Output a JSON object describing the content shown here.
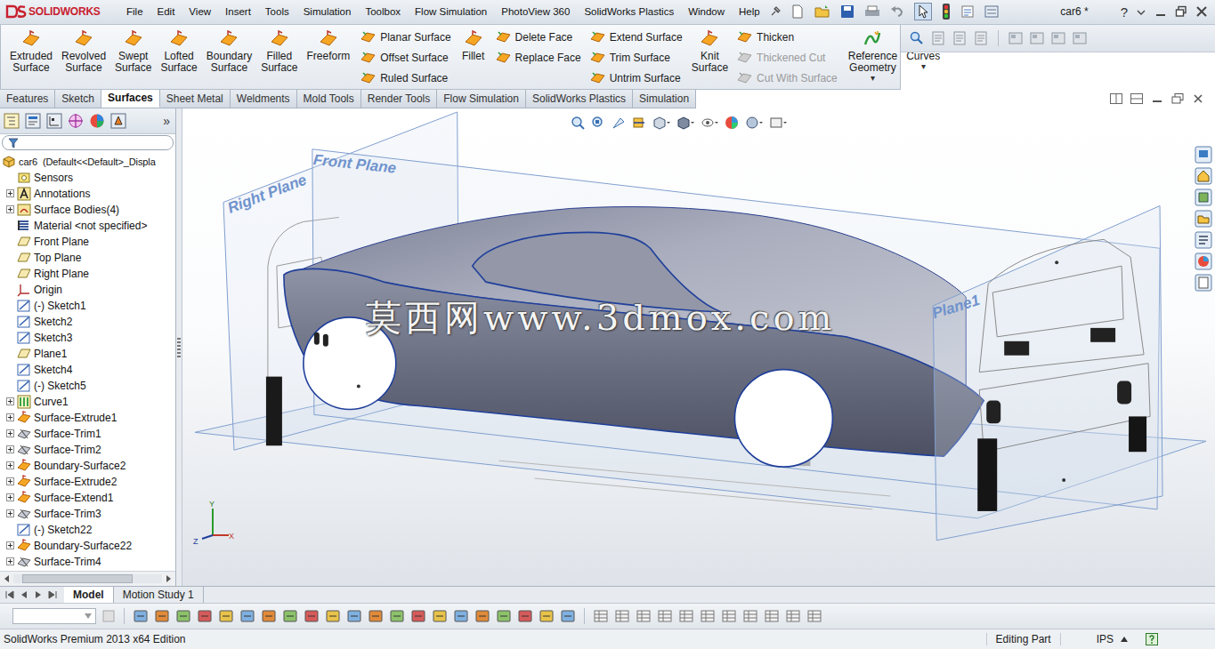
{
  "window": {
    "logo": "SOLIDWORKS",
    "document": "car6 *",
    "help": "?"
  },
  "menu": [
    "File",
    "Edit",
    "View",
    "Insert",
    "Tools",
    "Simulation",
    "Toolbox",
    "Flow Simulation",
    "PhotoView 360",
    "SolidWorks Plastics",
    "Window",
    "Help"
  ],
  "command_sections": [
    [
      {
        "kind": "large",
        "items": [
          {
            "label": "Extruded Surface",
            "disabled": false
          },
          {
            "label": "Revolved Surface",
            "disabled": false
          },
          {
            "label": "Swept Surface",
            "disabled": false
          },
          {
            "label": "Lofted Surface",
            "disabled": false
          },
          {
            "label": "Boundary Surface",
            "disabled": false
          },
          {
            "label": "Filled Surface",
            "disabled": false
          },
          {
            "label": "Freeform",
            "disabled": false
          }
        ]
      }
    ],
    [
      {
        "kind": "column",
        "items": [
          {
            "label": "Planar Surface",
            "disabled": false
          },
          {
            "label": "Offset Surface",
            "disabled": false
          },
          {
            "label": "Ruled Surface",
            "disabled": false
          }
        ]
      },
      {
        "kind": "large",
        "items": [
          {
            "label": "Fillet",
            "disabled": false
          }
        ]
      },
      {
        "kind": "column",
        "items": [
          {
            "label": "Delete Face",
            "disabled": false
          },
          {
            "label": "Replace Face",
            "disabled": false
          }
        ]
      }
    ],
    [
      {
        "kind": "column",
        "items": [
          {
            "label": "Extend Surface",
            "disabled": false
          },
          {
            "label": "Trim Surface",
            "disabled": false
          },
          {
            "label": "Untrim Surface",
            "disabled": false
          }
        ]
      },
      {
        "kind": "large",
        "items": [
          {
            "label": "Knit Surface",
            "disabled": false
          }
        ]
      },
      {
        "kind": "column",
        "items": [
          {
            "label": "Thicken",
            "disabled": false
          },
          {
            "label": "Thickened Cut",
            "disabled": true
          },
          {
            "label": "Cut With Surface",
            "disabled": true
          }
        ]
      }
    ],
    [
      {
        "kind": "large",
        "items": [
          {
            "label": "Reference Geometry",
            "disabled": false,
            "arrow": "▾"
          },
          {
            "label": "Curves",
            "disabled": false,
            "arrow": "▾"
          }
        ]
      }
    ]
  ],
  "tabs": [
    {
      "label": "Features",
      "selected": false
    },
    {
      "label": "Sketch",
      "selected": false
    },
    {
      "label": "Surfaces",
      "selected": true
    },
    {
      "label": "Sheet Metal",
      "selected": false
    },
    {
      "label": "Weldments",
      "selected": false
    },
    {
      "label": "Mold Tools",
      "selected": false
    },
    {
      "label": "Render Tools",
      "selected": false
    },
    {
      "label": "Flow Simulation",
      "selected": false
    },
    {
      "label": "SolidWorks Plastics",
      "selected": false
    },
    {
      "label": "Simulation",
      "selected": false
    }
  ],
  "panel": {
    "more": "»"
  },
  "feature_tree": {
    "root": "car6  (Default<<Default>_Displa",
    "items": [
      {
        "label": "Sensors",
        "kind": "sensor",
        "expandable": false,
        "expanded": false
      },
      {
        "label": "Annotations",
        "kind": "annotation",
        "expandable": true,
        "expanded": false
      },
      {
        "label": "Surface Bodies(4)",
        "kind": "bodies",
        "expandable": true,
        "expanded": false
      },
      {
        "label": "Material <not specified>",
        "kind": "material",
        "expandable": false,
        "expanded": false
      },
      {
        "label": "Front Plane",
        "kind": "plane",
        "expandable": false,
        "expanded": false
      },
      {
        "label": "Top Plane",
        "kind": "plane",
        "expandable": false,
        "expanded": false
      },
      {
        "label": "Right Plane",
        "kind": "plane",
        "expandable": false,
        "expanded": false
      },
      {
        "label": "Origin",
        "kind": "origin",
        "expandable": false,
        "expanded": false
      },
      {
        "label": "(-) Sketch1",
        "kind": "sketch",
        "expandable": false,
        "expanded": false
      },
      {
        "label": "Sketch2",
        "kind": "sketch",
        "expandable": false,
        "expanded": false
      },
      {
        "label": "Sketch3",
        "kind": "sketch",
        "expandable": false,
        "expanded": false
      },
      {
        "label": "Plane1",
        "kind": "plane",
        "expandable": false,
        "expanded": false
      },
      {
        "label": "Sketch4",
        "kind": "sketch",
        "expandable": false,
        "expanded": false
      },
      {
        "label": "(-) Sketch5",
        "kind": "sketch",
        "expandable": false,
        "expanded": false
      },
      {
        "label": "Curve1",
        "kind": "curve",
        "expandable": true,
        "expanded": false
      },
      {
        "label": "Surface-Extrude1",
        "kind": "feature",
        "expandable": true,
        "expanded": false
      },
      {
        "label": "Surface-Trim1",
        "kind": "trim",
        "expandable": true,
        "expanded": false
      },
      {
        "label": "Surface-Trim2",
        "kind": "trim",
        "expandable": true,
        "expanded": false
      },
      {
        "label": "Boundary-Surface2",
        "kind": "feature",
        "expandable": true,
        "expanded": false
      },
      {
        "label": "Surface-Extrude2",
        "kind": "feature",
        "expandable": true,
        "expanded": false
      },
      {
        "label": "Surface-Extend1",
        "kind": "feature",
        "expandable": true,
        "expanded": false
      },
      {
        "label": "Surface-Trim3",
        "kind": "trim",
        "expandable": true,
        "expanded": false
      },
      {
        "label": "(-) Sketch22",
        "kind": "sketch",
        "expandable": false,
        "expanded": false
      },
      {
        "label": "Boundary-Surface22",
        "kind": "feature",
        "expandable": true,
        "expanded": false
      },
      {
        "label": "Surface-Trim4",
        "kind": "trim",
        "expandable": true,
        "expanded": false
      }
    ]
  },
  "viewport": {
    "planes": [
      {
        "label": "Right Plane"
      },
      {
        "label": "Front Plane"
      },
      {
        "label": "Plane1"
      }
    ],
    "watermark": "莫西网www.3dmox.com",
    "triad": {
      "x": "X",
      "y": "Y",
      "z": "Z"
    }
  },
  "bottom_tabs": [
    {
      "label": "Model",
      "selected": true
    },
    {
      "label": "Motion Study 1",
      "selected": false
    }
  ],
  "status_bar": {
    "product": "SolidWorks Premium 2013 x64 Edition",
    "mode": "Editing Part",
    "units": "IPS"
  }
}
